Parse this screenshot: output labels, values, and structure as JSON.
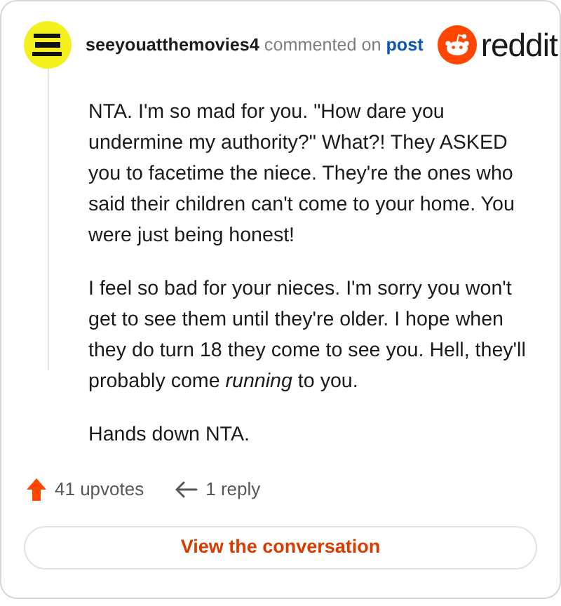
{
  "comment": {
    "author": "seeyouatthemovies4",
    "action": "commented on",
    "link": "post",
    "paragraphs": [
      "NTA. I'm so mad for you. \"How dare you undermine my authority?\" What?! They ASKED you to facetime the niece. They're the ones who said their children can't come to your home. You were just being honest!",
      "I feel so bad for your nieces. I'm sorry you won't get to see them until they're older. I hope when they do turn 18 they come to see you. Hell, they'll probably come *running* to you.",
      "Hands down NTA."
    ]
  },
  "brand": "reddit",
  "stats": {
    "upvotes": "41 upvotes",
    "replies": "1 reply"
  },
  "button": "View the conversation"
}
